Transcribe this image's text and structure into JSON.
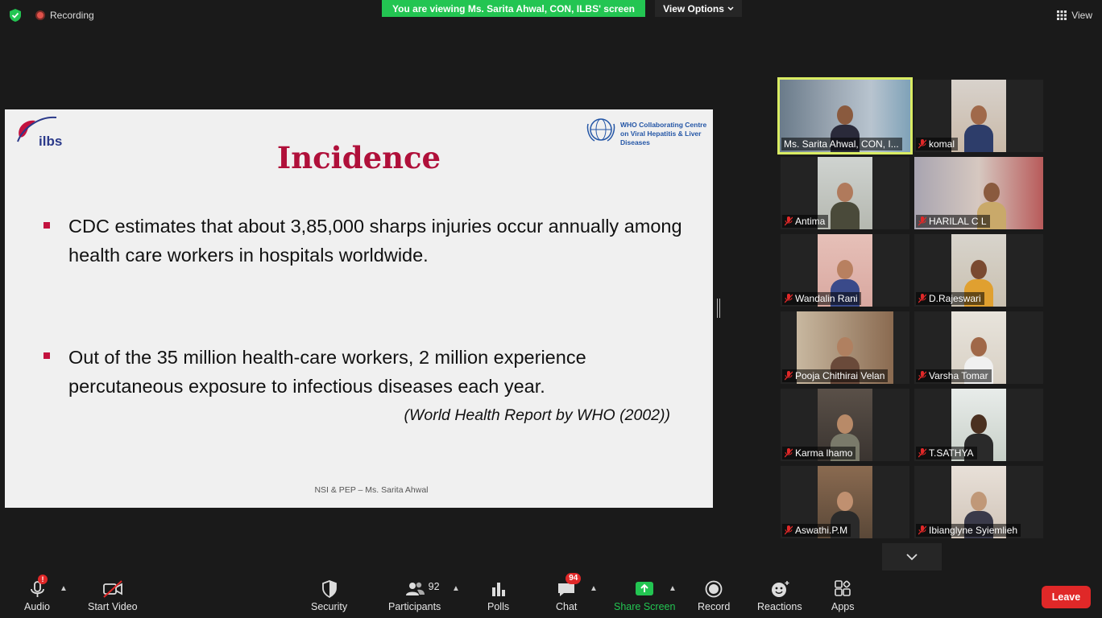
{
  "top_bar": {
    "recording_label": "Recording",
    "viewing_banner": "You are viewing Ms. Sarita Ahwal, CON, ILBS' screen",
    "view_options_label": "View Options",
    "view_label": "View",
    "banner_color": "#23c552"
  },
  "slide": {
    "title": "Incidence",
    "bullets": [
      "CDC estimates that about 3,85,000 sharps injuries occur annually among health care workers in hospitals worldwide.",
      "Out of the 35 million health-care workers, 2 million experience percutaneous exposure to infectious diseases each year."
    ],
    "citation": "(World Health Report by WHO (2002))",
    "footer": "NSI & PEP – Ms. Sarita Ahwal",
    "left_logo_text": "ilbs",
    "right_logo_text": "WHO Collaborating Centre on Viral Hepatitis & Liver Diseases",
    "title_color": "#b0103a"
  },
  "participants": [
    {
      "name": "Ms. Sarita Ahwal, CON, I...",
      "muted": false,
      "active": true
    },
    {
      "name": "komal",
      "muted": true,
      "active": false
    },
    {
      "name": "Antima",
      "muted": true,
      "active": false
    },
    {
      "name": "HARILAL C L",
      "muted": true,
      "active": false
    },
    {
      "name": "Wandalin Rani",
      "muted": true,
      "active": false
    },
    {
      "name": "D.Rajeswari",
      "muted": true,
      "active": false
    },
    {
      "name": "Pooja Chithirai Velan",
      "muted": true,
      "active": false
    },
    {
      "name": "Varsha Tomar",
      "muted": true,
      "active": false
    },
    {
      "name": "Karma lhamo",
      "muted": true,
      "active": false
    },
    {
      "name": "T.SATHYA",
      "muted": true,
      "active": false
    },
    {
      "name": "Aswathi.P.M",
      "muted": true,
      "active": false
    },
    {
      "name": "Ibianglyne Syiemlieh",
      "muted": true,
      "active": false
    }
  ],
  "toolbar": {
    "audio": "Audio",
    "start_video": "Start Video",
    "security": "Security",
    "participants": "Participants",
    "participants_count": "92",
    "polls": "Polls",
    "chat": "Chat",
    "chat_badge": "94",
    "share_screen": "Share Screen",
    "record": "Record",
    "reactions": "Reactions",
    "apps": "Apps",
    "leave": "Leave",
    "audio_alert": "!",
    "share_color": "#23c552",
    "leave_color": "#e02828"
  }
}
